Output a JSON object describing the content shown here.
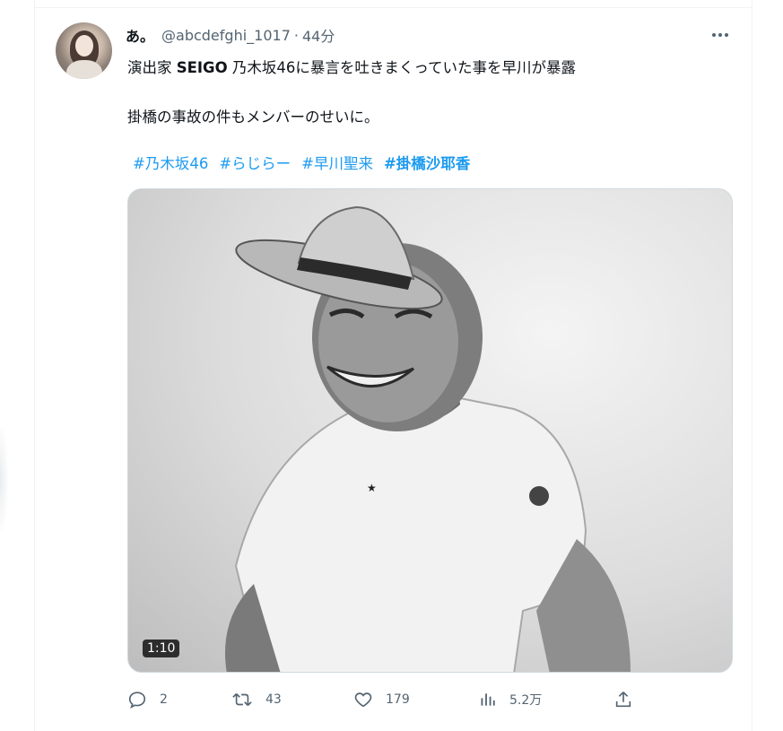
{
  "tweet": {
    "display_name": "あ。",
    "handle": "@abcdefghi_1017",
    "separator": "·",
    "time": "44分",
    "text_prefix": "演出家 ",
    "text_bold": "SEIGO",
    "text_rest": " 乃木坂46に暴言を吐きまくっていた事を早川が暴露",
    "text_line2": "掛橋の事故の件もメンバーのせいに。",
    "hashtags": [
      "#乃木坂46",
      "#らじらー",
      "#早川聖来",
      "#掛橋沙耶香"
    ]
  },
  "media": {
    "type": "video",
    "duration": "1:10"
  },
  "actions": {
    "replies": "2",
    "retweets": "43",
    "likes": "179",
    "views": "5.2万"
  },
  "icons": {
    "more": "more-icon",
    "reply": "reply-icon",
    "retweet": "retweet-icon",
    "like": "heart-icon",
    "views": "views-icon",
    "share": "share-icon"
  },
  "colors": {
    "link": "#1d9bf0",
    "secondary_text": "#536471",
    "primary_text": "#0f1419"
  }
}
